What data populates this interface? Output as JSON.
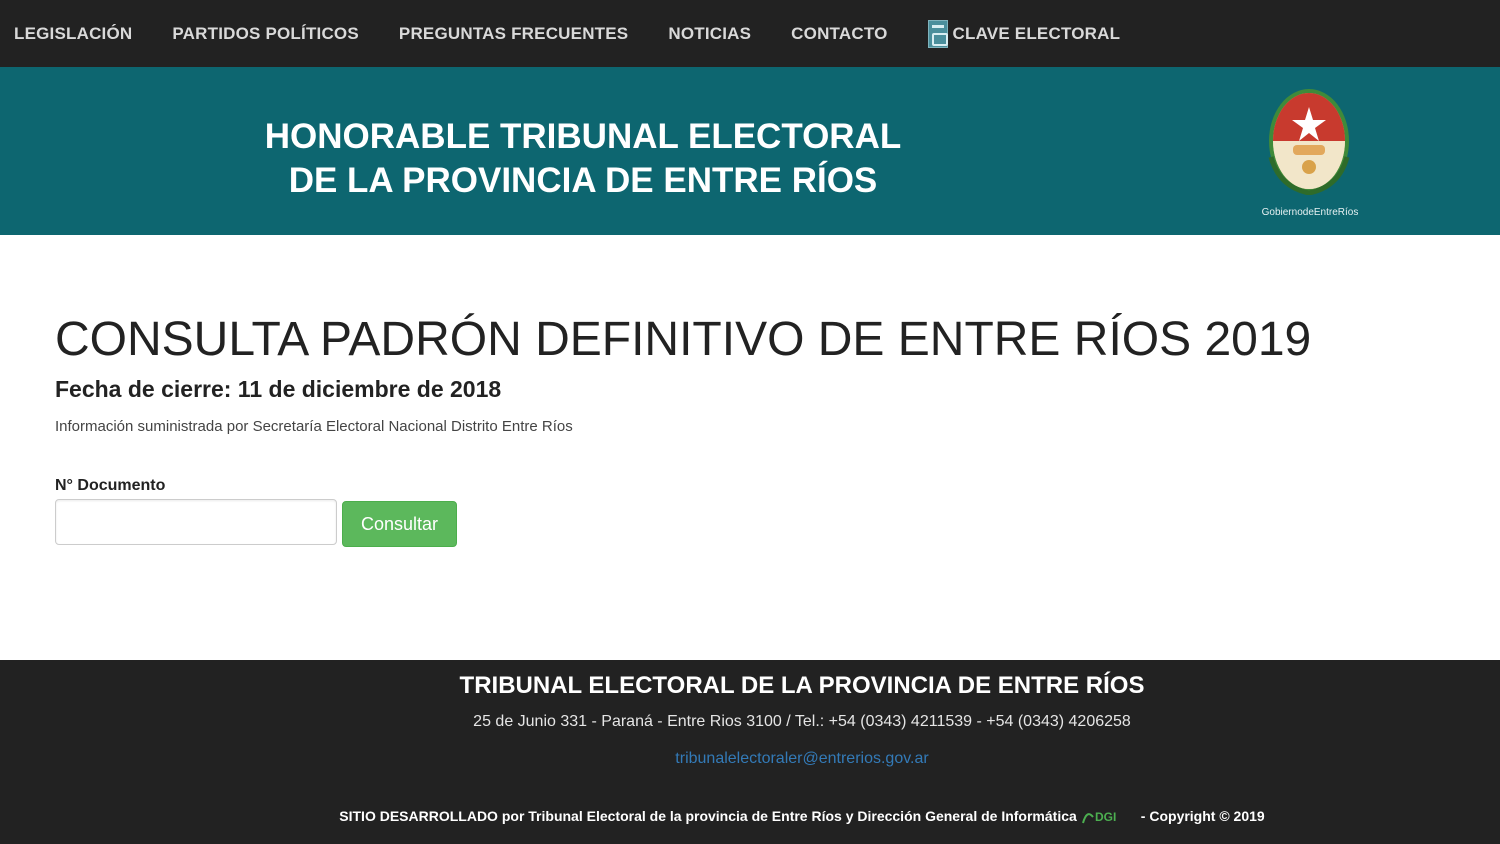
{
  "nav": {
    "items": [
      {
        "label": "LEGISLACIÓN"
      },
      {
        "label": "PARTIDOS POLÍTICOS"
      },
      {
        "label": "PREGUNTAS FRECUENTES"
      },
      {
        "label": "NOTICIAS"
      },
      {
        "label": "CONTACTO"
      },
      {
        "label": "CLAVE ELECTORAL",
        "icon": "key-card-icon"
      }
    ]
  },
  "banner": {
    "title_line1": "HONORABLE TRIBUNAL ELECTORAL",
    "title_line2": "DE LA PROVINCIA DE ENTRE RÍOS",
    "seal_caption": "GobiernodeEntreRíos",
    "colors": {
      "background": "#0d6670"
    }
  },
  "main": {
    "title": "CONSULTA PADRÓN DEFINITIVO DE ENTRE RÍOS 2019",
    "closing_date": "Fecha de cierre: 11 de diciembre de 2018",
    "info": "Información suministrada por Secretaría Electoral Nacional Distrito Entre Ríos",
    "form": {
      "document_label": "N° Documento",
      "document_value": "",
      "submit_label": "Consultar"
    },
    "colors": {
      "button": "#5cb85c"
    }
  },
  "footer": {
    "title": "TRIBUNAL ELECTORAL DE LA PROVINCIA DE ENTRE RÍOS",
    "address": "25 de Junio 331 - Paraná - Entre Rios 3100 / Tel.: +54 (0343) 4211539 - +54 (0343) 4206258",
    "email": "tribunalelectoraler@entrerios.gov.ar",
    "credits_before": "SITIO DESARROLLADO por Tribunal Electoral de la provincia de Entre Ríos y Dirección General de Informática",
    "credits_logo": "DGI",
    "credits_after": "- Copyright © 2019",
    "colors": {
      "background": "#222222",
      "link": "#337ab7"
    }
  }
}
